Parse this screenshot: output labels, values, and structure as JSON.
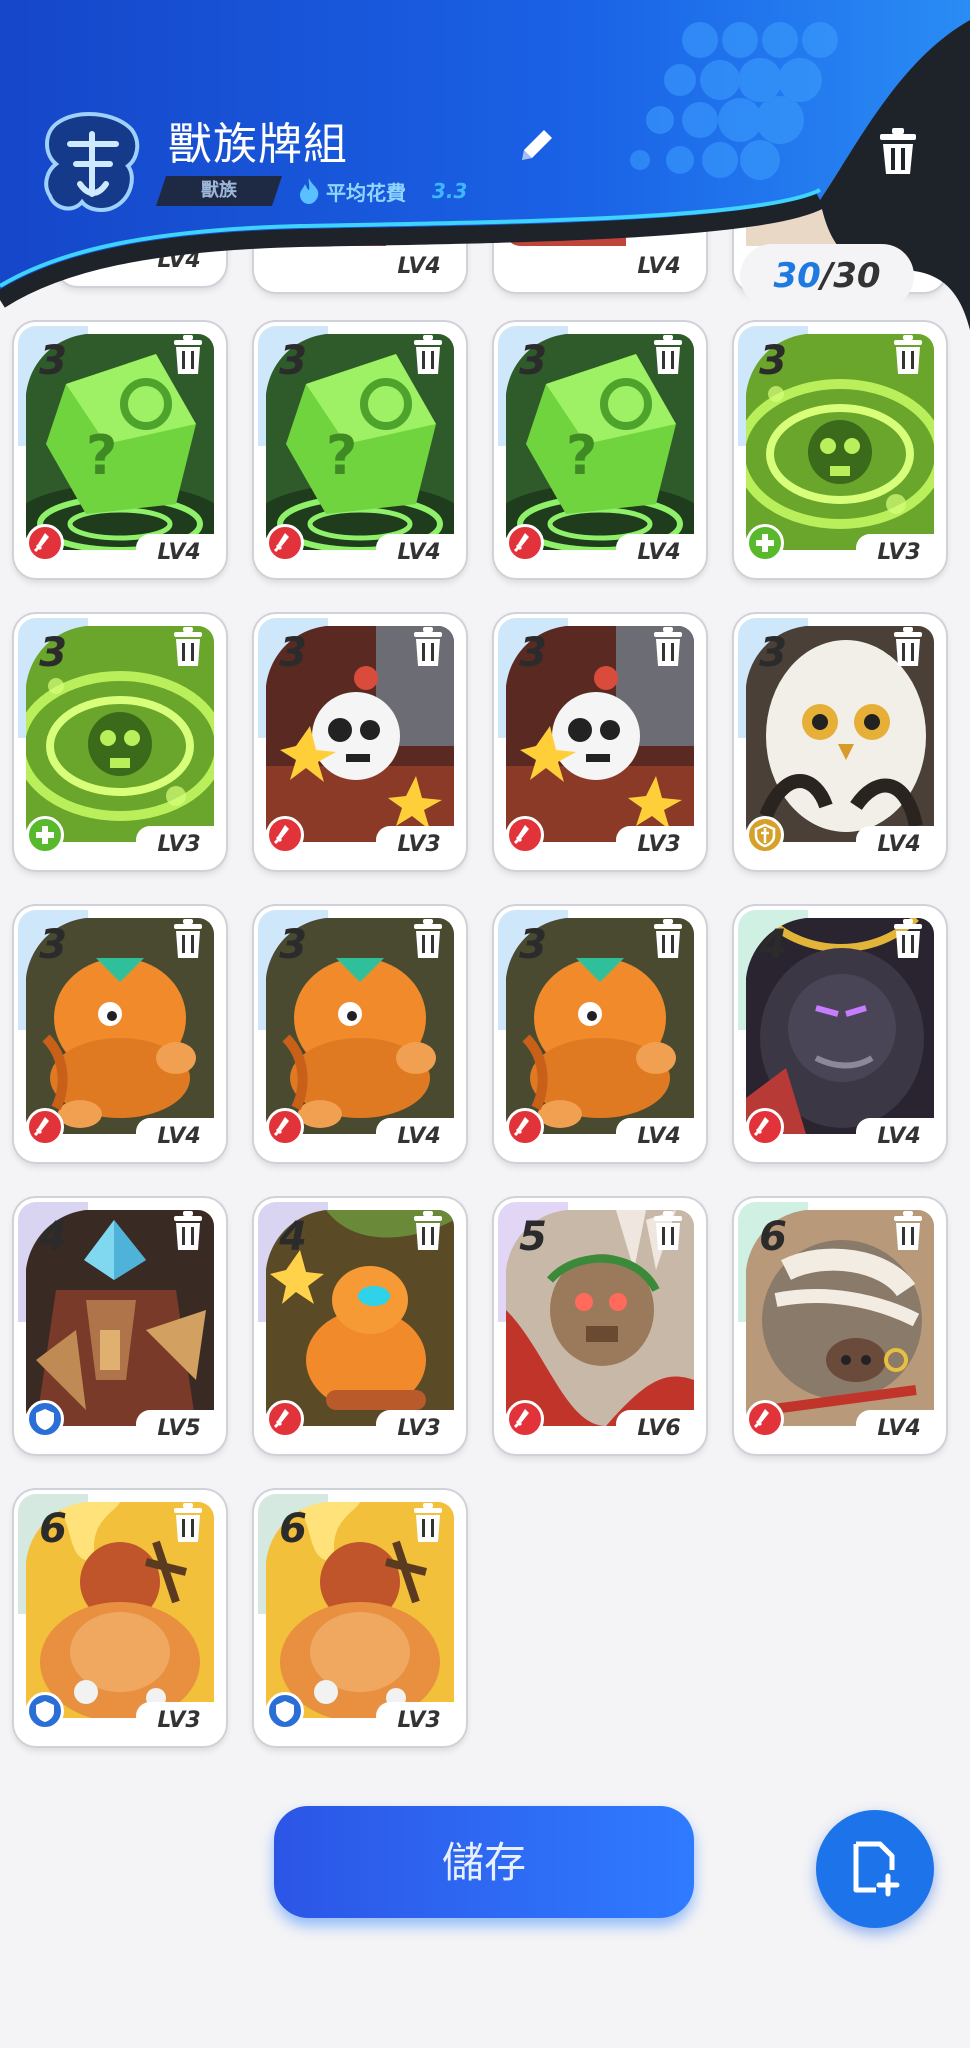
{
  "header": {
    "deck_title": "獸族牌組",
    "tribe_label": "獸族",
    "avg_cost_label": "平均花費",
    "avg_cost_value": "3.3",
    "card_count": "30",
    "card_separator": "/",
    "card_max": "30",
    "partial_levels": [
      "LV4",
      "LV4",
      "LV4"
    ]
  },
  "icons": {
    "logo": "tribe-emblem-icon",
    "edit": "pencil-icon",
    "delete_deck": "trash-icon",
    "card_delete": "trash-icon",
    "new_deck": "add-document-icon",
    "roles": {
      "attack": "sword-icon",
      "heal": "plus-icon",
      "defend": "shield-icon",
      "support": "sword-shield-icon"
    }
  },
  "colors": {
    "accent": "#1e7ae0",
    "header_blue": "#1a5fe0",
    "save_button": "#2c55e6"
  },
  "cards": [
    {
      "cost": "3",
      "level": "LV4",
      "role": "attack",
      "art": "green-box"
    },
    {
      "cost": "3",
      "level": "LV4",
      "role": "attack",
      "art": "green-box"
    },
    {
      "cost": "3",
      "level": "LV4",
      "role": "attack",
      "art": "green-box"
    },
    {
      "cost": "3",
      "level": "LV3",
      "role": "heal",
      "art": "skull-vortex"
    },
    {
      "cost": "3",
      "level": "LV3",
      "role": "heal",
      "art": "skull-vortex"
    },
    {
      "cost": "3",
      "level": "LV3",
      "role": "attack",
      "art": "skull-pirate"
    },
    {
      "cost": "3",
      "level": "LV3",
      "role": "attack",
      "art": "skull-pirate"
    },
    {
      "cost": "3",
      "level": "LV4",
      "role": "support",
      "art": "white-owl"
    },
    {
      "cost": "3",
      "level": "LV4",
      "role": "attack",
      "art": "orange-creature"
    },
    {
      "cost": "3",
      "level": "LV4",
      "role": "attack",
      "art": "orange-creature"
    },
    {
      "cost": "3",
      "level": "LV4",
      "role": "attack",
      "art": "orange-creature"
    },
    {
      "cost": "4",
      "level": "LV4",
      "role": "attack",
      "art": "black-beast"
    },
    {
      "cost": "4",
      "level": "LV5",
      "role": "defend",
      "art": "crystal-golem"
    },
    {
      "cost": "4",
      "level": "LV3",
      "role": "attack",
      "art": "orange-goggles"
    },
    {
      "cost": "5",
      "level": "LV6",
      "role": "attack",
      "art": "rabbit-mask"
    },
    {
      "cost": "6",
      "level": "LV4",
      "role": "attack",
      "art": "bandaged-boar"
    },
    {
      "cost": "6",
      "level": "LV3",
      "role": "defend",
      "art": "fire-warrior"
    },
    {
      "cost": "6",
      "level": "LV3",
      "role": "defend",
      "art": "fire-warrior"
    }
  ],
  "footer": {
    "save_label": "儲存"
  }
}
